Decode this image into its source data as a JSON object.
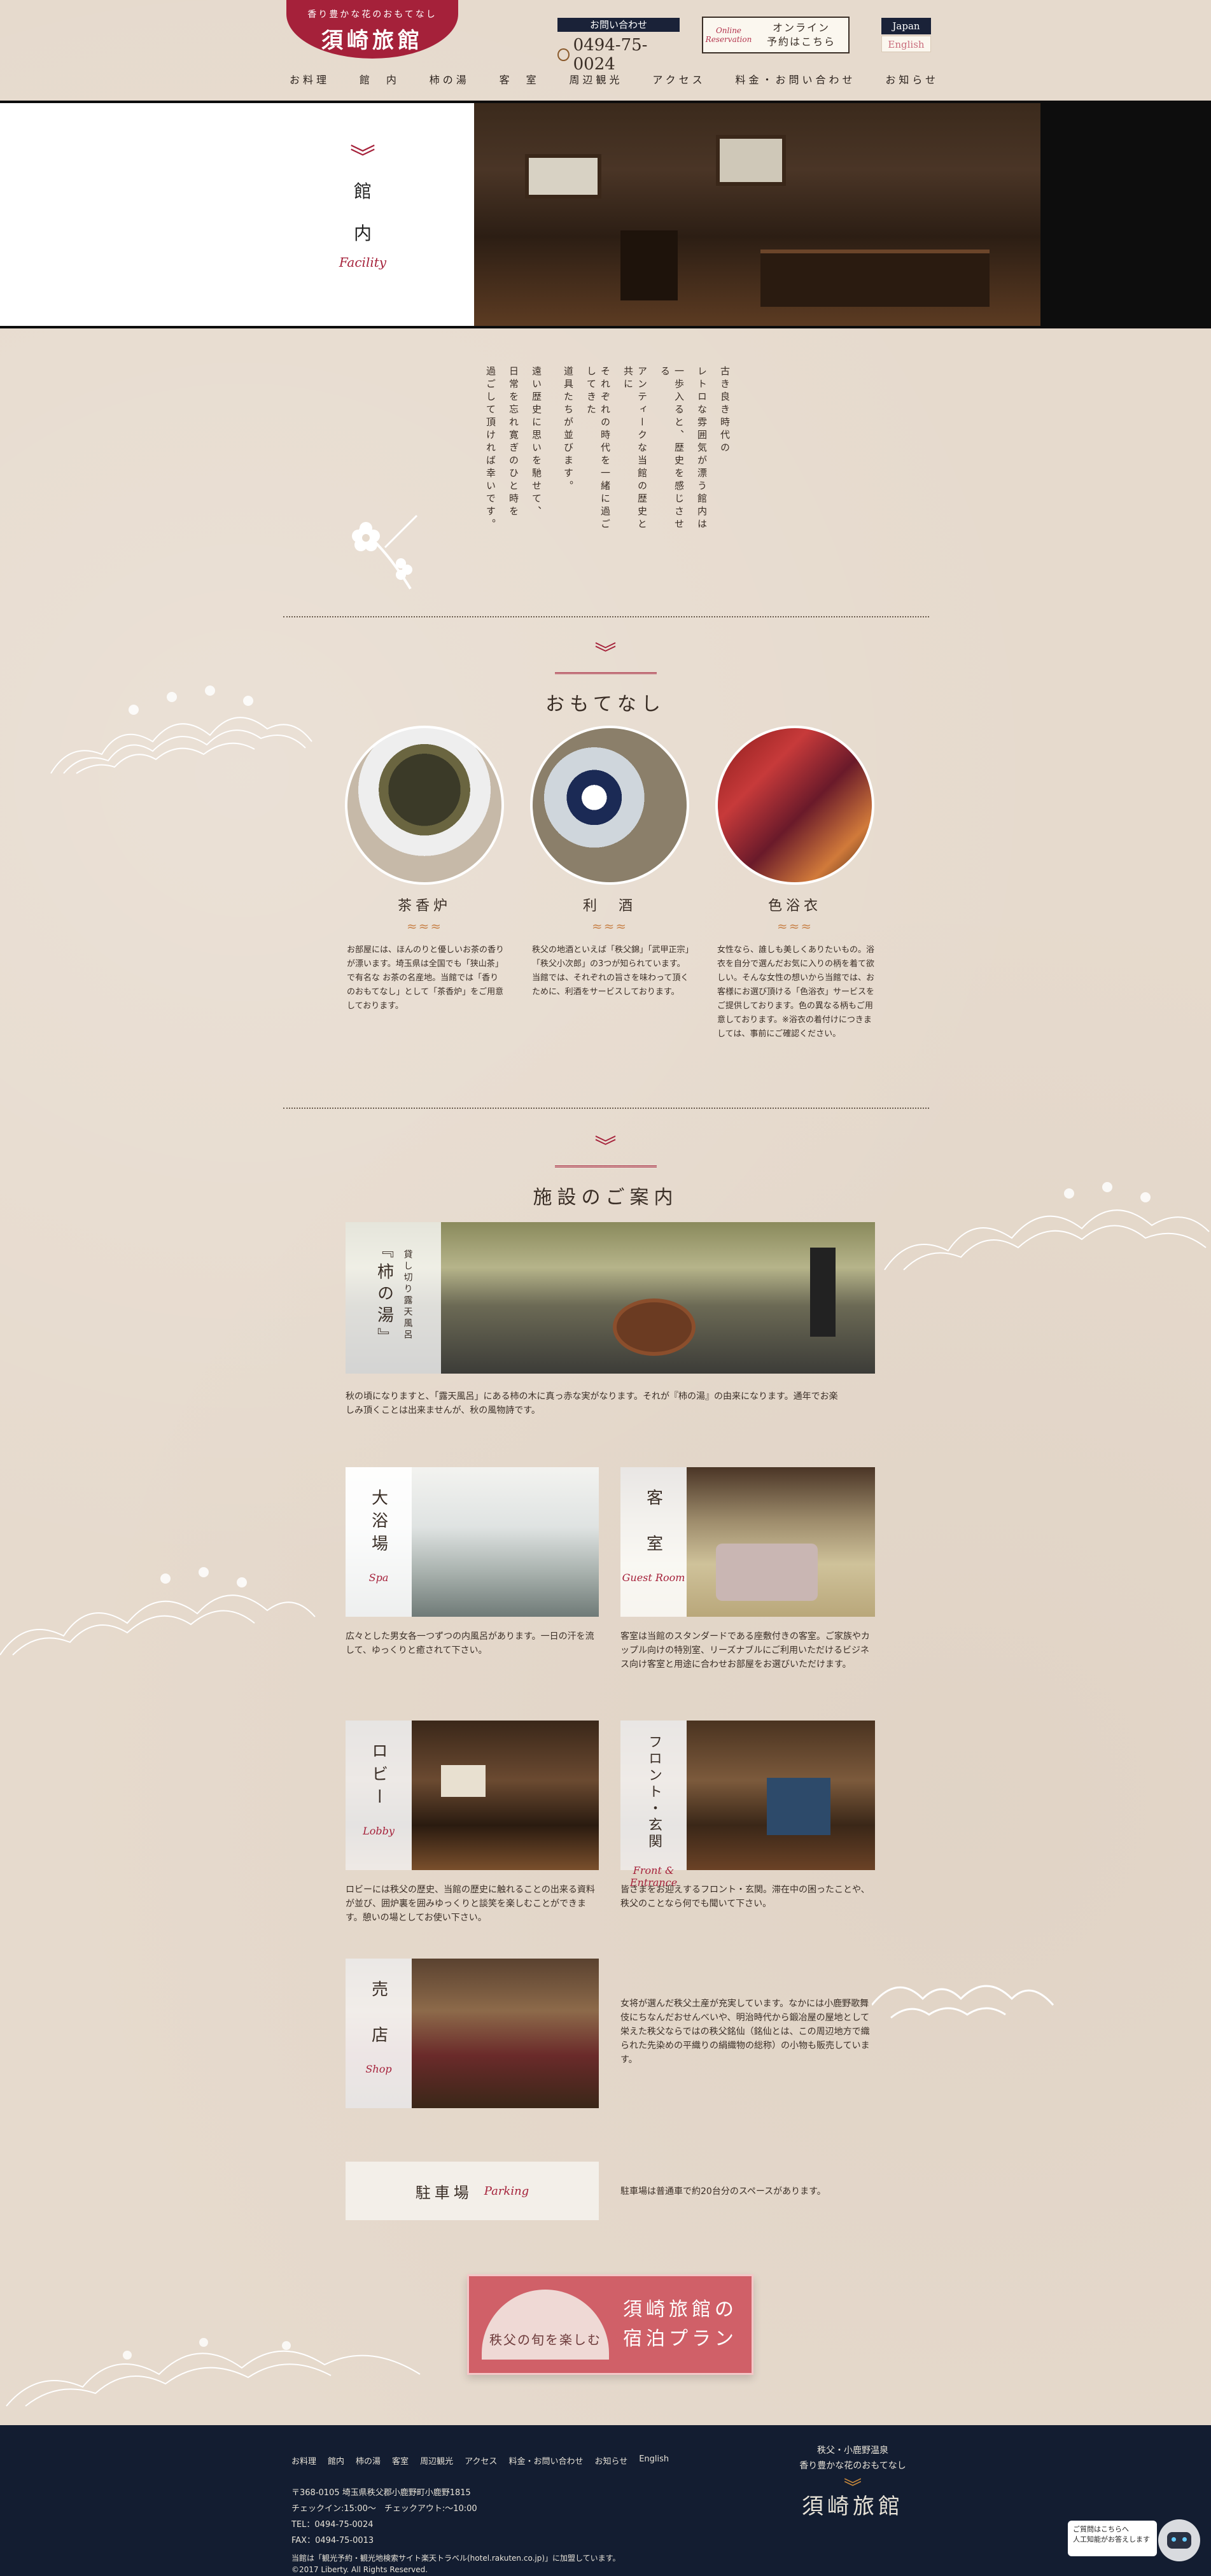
{
  "header": {
    "logo_tag": "香り豊かな花のおもてなし",
    "logo_name": "須崎旅館",
    "contact_label": "お問い合わせ",
    "tel": "0494-75-0024",
    "reserve_script": "Online Reservation",
    "reserve_line1": "オンライン",
    "reserve_line2": "予約はこちら",
    "lang_jp": "Japan",
    "lang_en": "English"
  },
  "nav": [
    "お料理",
    "館　内",
    "柿の湯",
    "客　室",
    "周辺観光",
    "アクセス",
    "料金・お問い合わせ",
    "お知らせ"
  ],
  "hero": {
    "title_1": "館",
    "title_2": "内",
    "title_en": "Facility"
  },
  "intro": {
    "cols": [
      "古き良き時代の",
      "レトロな雰囲気が漂う館内は",
      "一歩入ると、歴史を感じさせる",
      "アンティークな当館の歴史と共に",
      "それぞれの時代を一緒に過ごしてきた",
      "道具たちが並びます。",
      "",
      "遠い歴史に思いを馳せて、",
      "日常を忘れ寛ぎのひと時を",
      "過ごして頂ければ幸いです。"
    ]
  },
  "omotenashi": {
    "title": "おもてなし",
    "items": [
      {
        "name": "茶香炉",
        "text": "お部屋には、ほんのりと優しいお茶の香りが漂います。埼玉県は全国でも「狭山茶」で有名な お茶の名産地。当館では「香りのおもてなし」として「茶香炉」をご用意しております。"
      },
      {
        "name": "利　酒",
        "text": "秩父の地酒といえば「秩父錦」「武甲正宗」「秩父小次郎」の3つが知られています。当館では、それぞれの旨さを味わって頂くために、利酒をサービスしております。"
      },
      {
        "name": "色浴衣",
        "text": "女性なら、誰しも美しくありたいもの。浴衣を自分で選んだお気に入りの柄を着て欲しい。そんな女性の想いから当館では、お客様にお選び頂ける「色浴衣」サービスをご提供しております。色の異なる柄もご用意しております。※浴衣の着付けにつきましては、事前にご確認ください。"
      }
    ]
  },
  "facilities": {
    "title": "施設のご案内",
    "kakinoyu": {
      "sub": "貸し切り露天風呂",
      "name": "『柿の湯』",
      "text": "秋の頃になりますと、「露天風呂」にある柿の木に真っ赤な実がなります。それが『柿の湯』の由来になります。通年でお楽しみ頂くことは出来ませんが、秋の風物詩です。"
    },
    "spa": {
      "name": "大浴場",
      "en": "Spa",
      "text": "広々とした男女各一つずつの内風呂があります。一日の汗を流して、ゆっくりと癒されて下さい。"
    },
    "room": {
      "name": "客　室",
      "en": "Guest Room",
      "text": "客室は当館のスタンダードである座敷付きの客室。ご家族やカップル向けの特別室、リーズナブルにご利用いただけるビジネス向け客室と用途に合わせお部屋をお選びいただけます。"
    },
    "lobby": {
      "name": "ロビー",
      "en": "Lobby",
      "text": "ロビーには秩父の歴史、当館の歴史に触れることの出来る資料が並び、囲炉裏を囲みゆっくりと談笑を楽しむことができます。憩いの場としてお使い下さい。"
    },
    "front": {
      "name": "フロント・玄関",
      "en": "Front & Entrance",
      "text": "皆さまをお迎えするフロント・玄関。滞在中の困ったことや、秩父のことなら何でも聞いて下さい。"
    },
    "shop": {
      "name": "売　店",
      "en": "Shop",
      "text": "女将が選んだ秩父土産が充実しています。なかには小鹿野歌舞伎にちなんだおせんべいや、明治時代から鍛冶屋の屋地として栄えた秩父ならではの秩父銘仙（銘仙とは、この周辺地方で織られた先染めの平織りの絹織物の総称）の小物も販売しています。"
    },
    "parking": {
      "name": "駐車場",
      "en": "Parking",
      "text": "駐車場は普通車で約20台分のスペースがあります。"
    }
  },
  "banner": {
    "fan": "秩父の旬を楽しむ",
    "line1": "須崎旅館の",
    "line2": "宿泊プラン"
  },
  "footer": {
    "nav": [
      "お料理",
      "館内",
      "柿の湯",
      "客室",
      "周辺観光",
      "アクセス",
      "料金・お問い合わせ",
      "お知らせ",
      "English"
    ],
    "address": "〒368-0105 埼玉県秩父郡小鹿野町小鹿野1815",
    "checkin": "チェックイン:15:00〜　チェックアウト:〜10:00",
    "tel": "TEL：0494-75-0024",
    "fax": "FAX：0494-75-0013",
    "note": "当館は「観光予約・観光地検索サイト楽天トラベル(hotel.rakuten.co.jp)」に加盟しています。",
    "copyright": "©2017 Liberty. All Rights Reserved.",
    "brand_line1": "秩父・小鹿野温泉",
    "brand_line2": "香り豊かな花のおもてなし",
    "brand_name": "須崎旅館"
  },
  "chat": {
    "line1": "ご質問はこちらへ",
    "line2": "人工知能がお答えします"
  },
  "colors": {
    "accent": "#a5213a",
    "footer_bg": "#131d31",
    "paper": "#e6dacd"
  }
}
